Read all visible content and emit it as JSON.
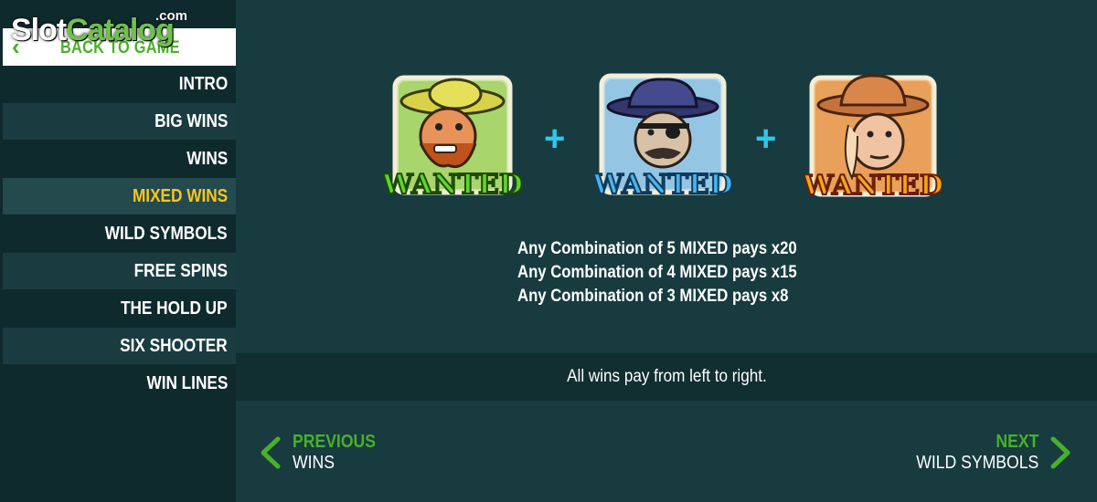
{
  "watermark": {
    "part1": "Slot",
    "part2": "Catalog",
    "suffix": ".com"
  },
  "back_button": {
    "label": "BACK TO GAME",
    "icon": "chevron-left-icon"
  },
  "menu": {
    "items": [
      {
        "label": "INTRO"
      },
      {
        "label": "BIG WINS"
      },
      {
        "label": "WINS"
      },
      {
        "label": "MIXED WINS",
        "active": true
      },
      {
        "label": "WILD SYMBOLS"
      },
      {
        "label": "FREE SPINS"
      },
      {
        "label": "THE HOLD UP"
      },
      {
        "label": "SIX SHOOTER"
      },
      {
        "label": "WIN LINES"
      }
    ]
  },
  "symbols": [
    {
      "icon": "wanted-outlaw-sombrero-icon",
      "label": "WANTED",
      "color": "#5ed62a"
    },
    {
      "icon": "wanted-outlaw-eyepatch-icon",
      "label": "WANTED",
      "color": "#4ab3e8"
    },
    {
      "icon": "wanted-outlaw-cowboy-icon",
      "label": "WANTED",
      "color": "#f2a51c"
    }
  ],
  "plus_sign": "+",
  "pays": [
    "Any Combination of 5 MIXED pays x20",
    "Any Combination of 4 MIXED pays x15",
    "Any Combination of 3 MIXED pays x8"
  ],
  "footer_note": "All wins pay from left to right.",
  "nav": {
    "previous": {
      "title": "PREVIOUS",
      "subtitle": "WINS",
      "icon": "chevron-left-icon"
    },
    "next": {
      "title": "NEXT",
      "subtitle": "WILD SYMBOLS",
      "icon": "chevron-right-icon"
    }
  },
  "colors": {
    "accent_green": "#49b02a",
    "active_yellow": "#f7c61f",
    "plus_cyan": "#33c6e6",
    "background": "#173b3f"
  }
}
